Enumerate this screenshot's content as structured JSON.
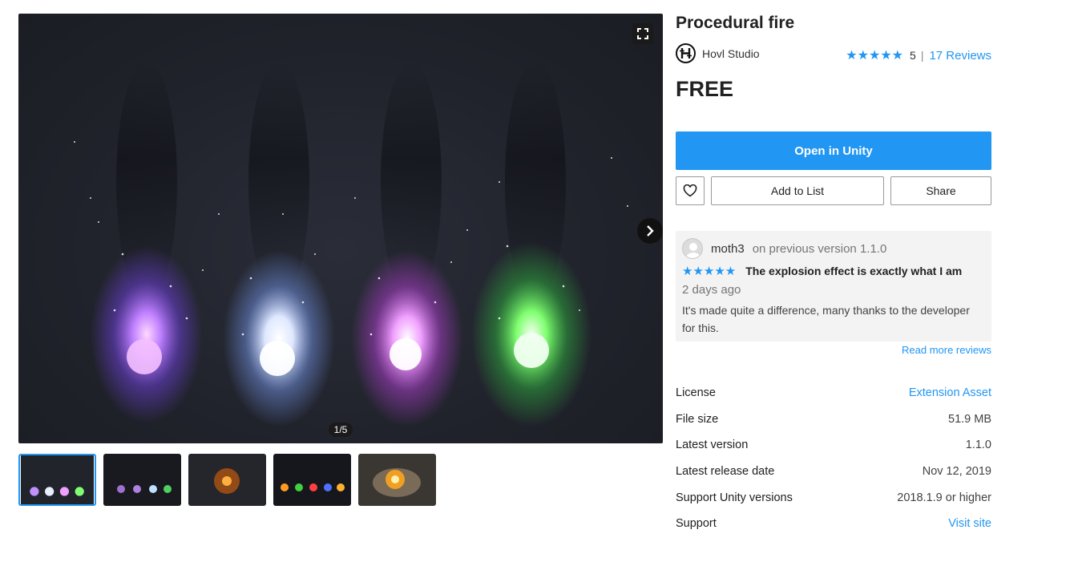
{
  "product": {
    "title": "Procedural fire",
    "publisher": "Hovl Studio",
    "publisher_logo_glyph": "H",
    "rating_stars": 5,
    "rating_value": "5",
    "rating_separator": "|",
    "reviews_link": "17 Reviews",
    "price": "FREE"
  },
  "actions": {
    "open_label": "Open in Unity",
    "add_to_list_label": "Add to List",
    "share_label": "Share",
    "favorite_icon": "heart-icon"
  },
  "gallery": {
    "counter": "1/5",
    "expand_icon": "expand-icon",
    "next_icon": "chevron-right-icon",
    "flame_colors": [
      "#a070ff",
      "#c8d8ff",
      "#e070ff",
      "#50e060"
    ],
    "thumbnails": [
      {
        "label": "thumb-1",
        "active": true
      },
      {
        "label": "thumb-2",
        "active": false
      },
      {
        "label": "thumb-3",
        "active": false
      },
      {
        "label": "thumb-4",
        "active": false
      },
      {
        "label": "thumb-5",
        "active": false
      }
    ]
  },
  "review": {
    "user": "moth3",
    "version": "on previous version 1.1.0",
    "stars": 5,
    "title": "The explosion effect is exactly what I am",
    "date": "2 days ago",
    "body": "It's made quite a difference, many thanks to the developer for this.",
    "read_more": "Read more reviews"
  },
  "details": [
    {
      "label": "License",
      "value": "Extension Asset",
      "link": true
    },
    {
      "label": "File size",
      "value": "51.9 MB",
      "link": false
    },
    {
      "label": "Latest version",
      "value": "1.1.0",
      "link": false
    },
    {
      "label": "Latest release date",
      "value": "Nov 12, 2019",
      "link": false
    },
    {
      "label": "Support Unity versions",
      "value": "2018.1.9 or higher",
      "link": false
    },
    {
      "label": "Support",
      "value": "Visit site",
      "link": true
    }
  ],
  "colors": {
    "accent": "#2196f3",
    "review_bg": "#f3f3f3"
  }
}
